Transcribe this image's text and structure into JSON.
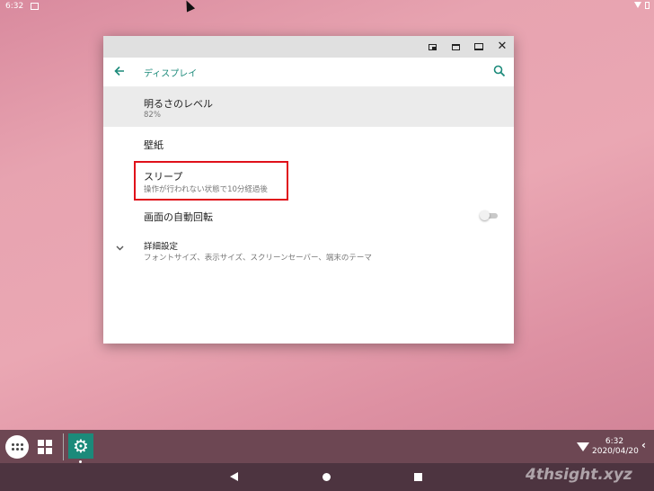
{
  "status_bar": {
    "time": "6:32"
  },
  "window": {
    "app_title": "ディスプレイ",
    "items": {
      "brightness": {
        "label": "明るさのレベル",
        "value": "82%"
      },
      "wallpaper": {
        "label": "壁紙"
      },
      "sleep": {
        "label": "スリープ",
        "summary": "操作が行われない状態で10分経過後"
      },
      "auto_rotate": {
        "label": "画面の自動回転",
        "enabled": false
      },
      "advanced": {
        "label": "詳細設定",
        "summary": "フォントサイズ、表示サイズ、スクリーンセーバー、端末のテーマ"
      }
    }
  },
  "taskbar": {
    "time": "6:32",
    "date": "2020/04/20"
  },
  "watermark": "4thsight.xyz",
  "colors": {
    "accent": "#1b8a7a",
    "highlight": "#e0101a"
  }
}
